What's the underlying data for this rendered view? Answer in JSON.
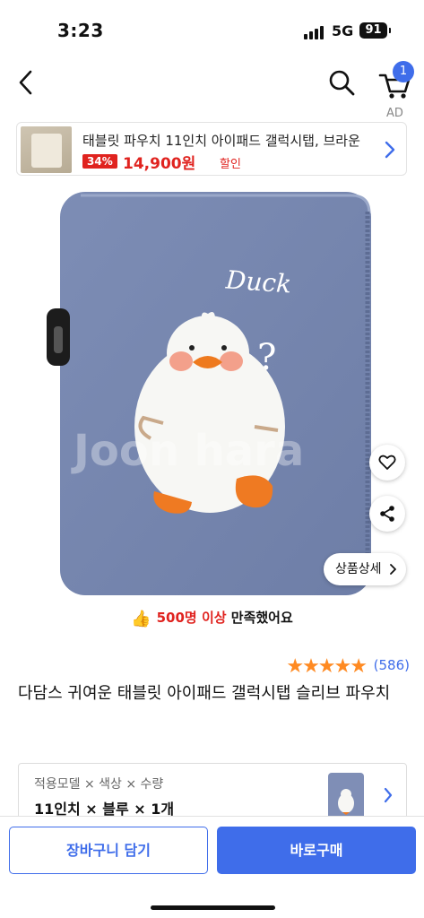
{
  "status_bar": {
    "time": "3:23",
    "network": "5G",
    "battery": "91"
  },
  "nav": {
    "cart_count": "1",
    "ad_label": "AD"
  },
  "ad_banner": {
    "title": "태블릿 파우치 11인치 아이패드 갤럭시탭, 브라운",
    "discount": "34%",
    "price": "14,900원",
    "sale_label": "할인",
    "accent_color": "#e0231f"
  },
  "product": {
    "image_text": "Duck",
    "image_question": "?",
    "watermark": "Joon hara",
    "detail_button": "상품상세",
    "satisfaction_prefix": "500명 이상",
    "satisfaction_suffix": " 만족했어요",
    "rating_stars": 5,
    "review_count": "(586)",
    "title": "다담스 귀여운 태블릿 아이패드 갤럭시탭 슬리브 파우치"
  },
  "options": {
    "label": "적용모델 × 색상 × 수량",
    "value": "11인치 × 블루 × 1개"
  },
  "actions": {
    "cart_button": "장바구니 담기",
    "buy_button": "바로구매",
    "brand_color": "#3f6dea"
  },
  "icons": [
    "back-icon",
    "search-icon",
    "cart-icon",
    "chevron-right-icon",
    "heart-icon",
    "share-icon",
    "thumbs-up-icon",
    "star-icon"
  ]
}
